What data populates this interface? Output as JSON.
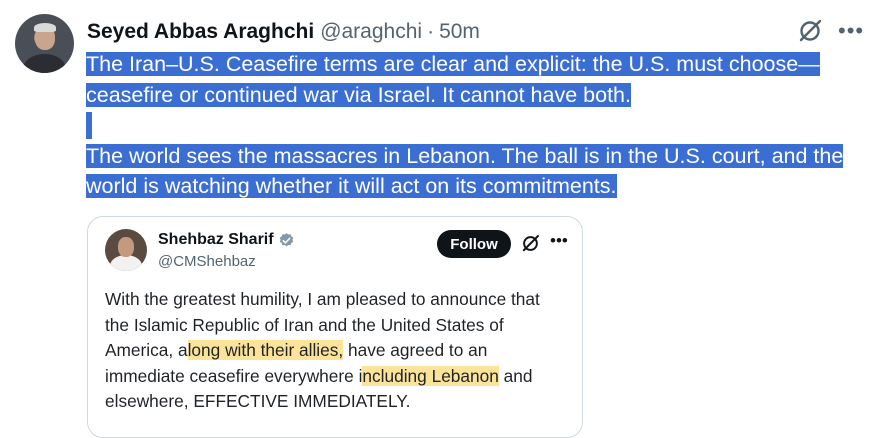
{
  "tweet": {
    "author_name": "Seyed Abbas Araghchi",
    "author_handle": "@araghchi",
    "separator": "·",
    "time": "50m",
    "paragraph1": "The Iran–U.S. Ceasefire terms are clear and explicit: the U.S. must choose—ceasefire or continued war via Israel. It cannot have both.",
    "paragraph2": "The world sees the massacres in Lebanon. The ball is in the U.S. court, and the world is watching whether it will act on its commitments.",
    "icons": [
      "grok-icon",
      "more-icon"
    ]
  },
  "quote": {
    "author_name": "Shehbaz Sharif",
    "author_handle": "@CMShehbaz",
    "follow_label": "Follow",
    "text_before_1": "With the greatest humility, I am pleased to announce that the Islamic Republic of Iran and the United States of America, a",
    "highlight_1": "long with their allies,",
    "text_mid": " have agreed to an immediate ceasefire everywhere i",
    "highlight_2": "ncluding Lebanon",
    "text_after": " and elsewhere, EFFECTIVE IMMEDIATELY.",
    "icons": [
      "verified-icon",
      "grok-icon",
      "more-icon"
    ]
  },
  "colors": {
    "selection_highlight": "#3b6ed3",
    "marker_highlight": "#fbe49a",
    "verified": "#829aab",
    "secondary_text": "#536471"
  }
}
